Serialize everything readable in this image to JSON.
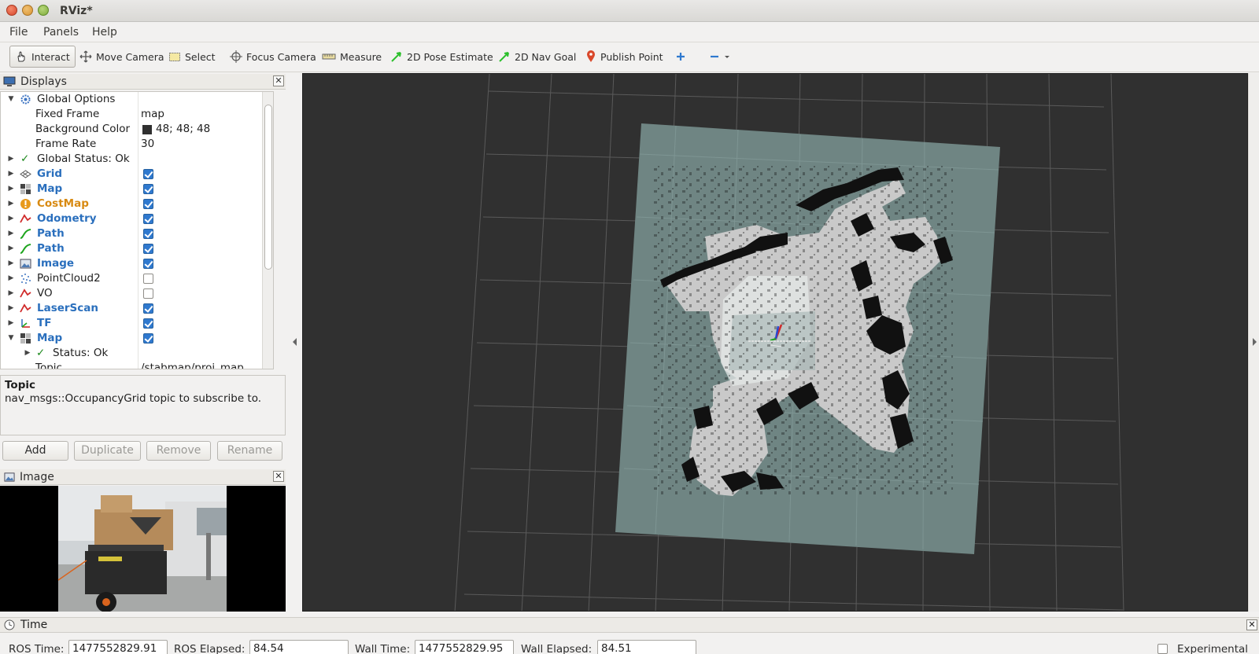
{
  "window": {
    "title": "RViz*"
  },
  "menu": [
    "File",
    "Panels",
    "Help"
  ],
  "toolbar": {
    "interact": "Interact",
    "move_camera": "Move Camera",
    "select": "Select",
    "focus_camera": "Focus Camera",
    "measure": "Measure",
    "pose_estimate": "2D Pose Estimate",
    "nav_goal": "2D Nav Goal",
    "publish_point": "Publish Point"
  },
  "displays": {
    "title": "Displays",
    "global_options": "Global Options",
    "fixed_frame_label": "Fixed Frame",
    "fixed_frame_value": "map",
    "bg_color_label": "Background Color",
    "bg_color_value": "48; 48; 48",
    "frame_rate_label": "Frame Rate",
    "frame_rate_value": "30",
    "global_status": "Global Status: Ok",
    "items": [
      {
        "label": "Grid",
        "checked": true,
        "style": "blue"
      },
      {
        "label": "Map",
        "checked": true,
        "style": "blue"
      },
      {
        "label": "CostMap",
        "checked": true,
        "style": "orange"
      },
      {
        "label": "Odometry",
        "checked": true,
        "style": "blue"
      },
      {
        "label": "Path",
        "checked": true,
        "style": "blue"
      },
      {
        "label": "Path",
        "checked": true,
        "style": "blue"
      },
      {
        "label": "Image",
        "checked": true,
        "style": "blue"
      },
      {
        "label": "PointCloud2",
        "checked": false,
        "style": "plain"
      },
      {
        "label": "VO",
        "checked": false,
        "style": "plain"
      },
      {
        "label": "LaserScan",
        "checked": true,
        "style": "blue"
      },
      {
        "label": "TF",
        "checked": true,
        "style": "blue"
      },
      {
        "label": "Map",
        "checked": true,
        "style": "blue"
      }
    ],
    "status_ok": "Status: Ok",
    "topic_label": "Topic",
    "topic_value": "/stabmap/proj_map"
  },
  "description": {
    "heading": "Topic",
    "text": "nav_msgs::OccupancyGrid topic to subscribe to."
  },
  "buttons": {
    "add": "Add",
    "duplicate": "Duplicate",
    "remove": "Remove",
    "rename": "Rename"
  },
  "image_panel": {
    "title": "Image"
  },
  "time_panel": {
    "title": "Time",
    "ros_time_label": "ROS Time:",
    "ros_time_value": "1477552829.91",
    "ros_elapsed_label": "ROS Elapsed:",
    "ros_elapsed_value": "84.54",
    "wall_time_label": "Wall Time:",
    "wall_time_value": "1477552829.95",
    "wall_elapsed_label": "Wall Elapsed:",
    "wall_elapsed_value": "84.51",
    "experimental_label": "Experimental"
  },
  "colors": {
    "background": "#303030",
    "map_free": "#c8c8c8",
    "map_unknown": "#6f8583",
    "accent_blue": "#2a6fbd"
  }
}
